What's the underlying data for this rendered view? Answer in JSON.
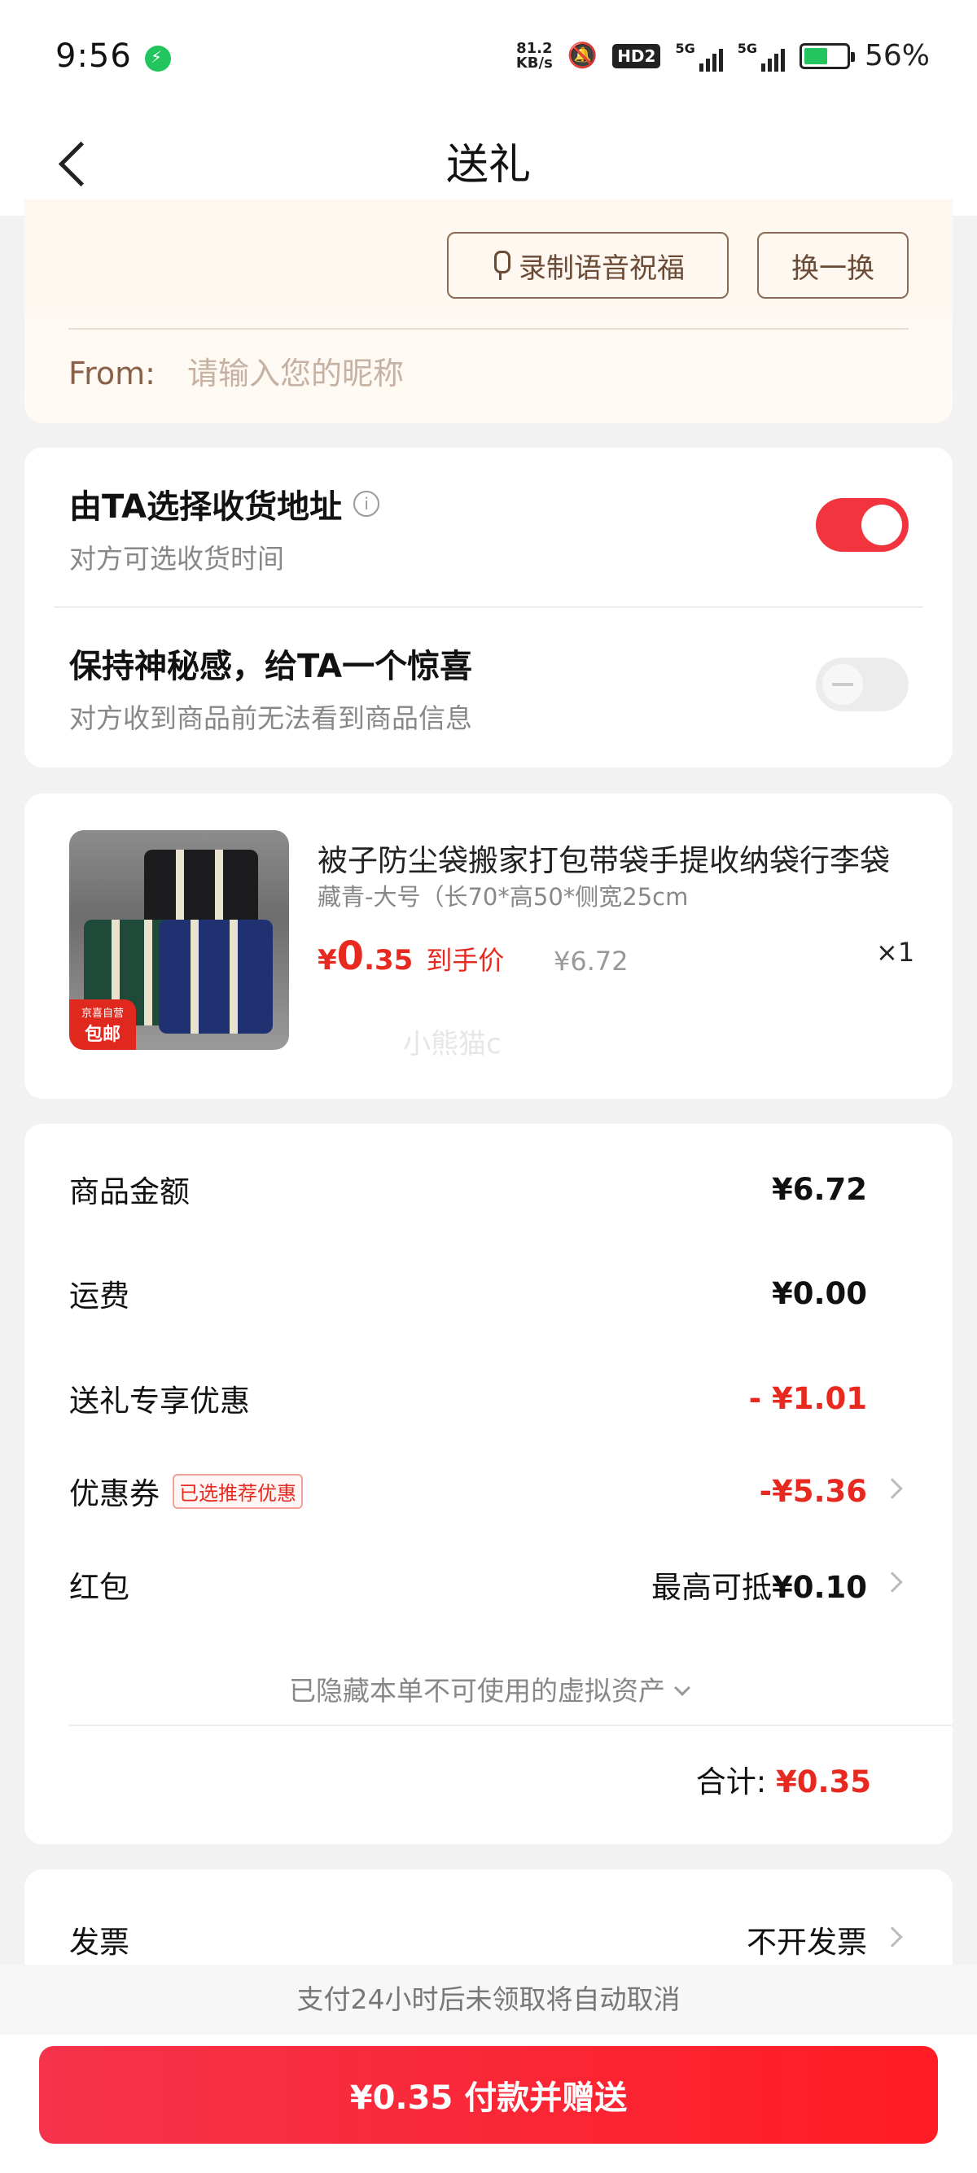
{
  "status_bar": {
    "time": "9:56",
    "net_speed_value": "81.2",
    "net_speed_unit": "KB/s",
    "hd_label": "HD2",
    "signal_label_1": "5G",
    "signal_label_2": "5G",
    "battery_percent": "56%",
    "battery_level": 0.56,
    "charge_color": "#22c55e"
  },
  "header": {
    "title": "送礼",
    "back_icon": "chevron-left-icon"
  },
  "greeting": {
    "voice_button": "录制语音祝福",
    "swap_button": "换一换",
    "from_label": "From:",
    "from_placeholder": "请输入您的昵称",
    "from_value": ""
  },
  "options": [
    {
      "title": "由TA选择收货地址",
      "subtitle": "对方可选收货时间",
      "enabled": true,
      "has_info_icon": true
    },
    {
      "title": "保持神秘感，给TA一个惊喜",
      "subtitle": "对方收到商品前无法看到商品信息",
      "enabled": false,
      "has_info_icon": false
    }
  ],
  "product": {
    "title": "被子防尘袋搬家打包带袋手提收纳袋行李袋",
    "spec": "藏青-大号（长70*高50*侧宽25cm",
    "price_currency": "¥",
    "price_int": "0",
    "price_dec": ".35",
    "price_tag": "到手价",
    "original_price": "¥6.72",
    "quantity": "×1",
    "badge_top": "京喜自营",
    "badge_main": "包邮",
    "watermark": "小熊猫c"
  },
  "summary": {
    "rows": [
      {
        "label": "商品金额",
        "value": "¥6.72"
      },
      {
        "label": "运费",
        "value": "¥0.00"
      },
      {
        "label": "送礼专享优惠",
        "value": "- ¥1.01"
      },
      {
        "label": "优惠券",
        "tag": "已选推荐优惠",
        "value": "-¥5.36"
      },
      {
        "label": "红包",
        "value_prefix": "最高可抵",
        "value": "¥0.10"
      }
    ],
    "hidden_assets": "已隐藏本单不可使用的虚拟资产",
    "total_label": "合计:",
    "total_value": "¥0.35"
  },
  "invoice": {
    "label": "发票",
    "value": "不开发票"
  },
  "bottom": {
    "notice": "支付24小时后未领取将自动取消",
    "pay_button": "¥0.35 付款并赠送"
  },
  "colors": {
    "accent_red": "#e8291f",
    "toggle_on": "#f2343f",
    "greeting_brown": "#8a6048"
  }
}
